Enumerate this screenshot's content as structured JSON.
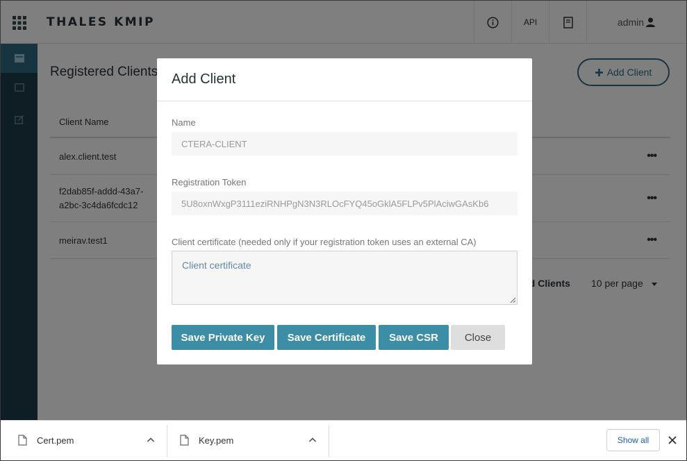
{
  "header": {
    "brand": "THALES KMIP",
    "api_label": "API",
    "user_label": "admin"
  },
  "main": {
    "title": "Registered Clients",
    "add_client_label": "Add Client",
    "table": {
      "columns": [
        "Client Name"
      ],
      "rows": [
        {
          "name": "alex.client.test"
        },
        {
          "name": "f2dab85f-addd-43a7-\na2bc-3c4da6fcdc12"
        },
        {
          "name": "meirav.test1"
        }
      ]
    },
    "pager": {
      "total_label": "ed Clients",
      "per_page": "10 per page"
    }
  },
  "modal": {
    "title": "Add Client",
    "name_label": "Name",
    "name_value": "CTERA-CLIENT",
    "token_label": "Registration Token",
    "token_value": "5U8oxnWxgP3111eziRNHPgN3N3RLOcFYQ45oGklA5FLPv5PlAciwGAsKb6",
    "cert_label": "Client certificate (needed only if your registration token uses an external CA)",
    "cert_placeholder": "Client certificate",
    "buttons": {
      "save_private_key": "Save Private Key",
      "save_certificate": "Save Certificate",
      "save_csr": "Save CSR",
      "close": "Close"
    }
  },
  "downloads": {
    "items": [
      {
        "name": "Cert.pem"
      },
      {
        "name": "Key.pem"
      }
    ],
    "show_all": "Show all"
  },
  "icons": {
    "grid": "apps-grid-icon",
    "info": "info-icon",
    "docs": "book-icon",
    "user": "user-icon",
    "plus": "plus-icon",
    "file": "file-icon",
    "chevron": "chevron-up-icon",
    "close": "close-icon"
  },
  "colors": {
    "sidebar": "#1d3c48",
    "accent": "#3b8ea5",
    "add_button": "#2b6d7f"
  }
}
